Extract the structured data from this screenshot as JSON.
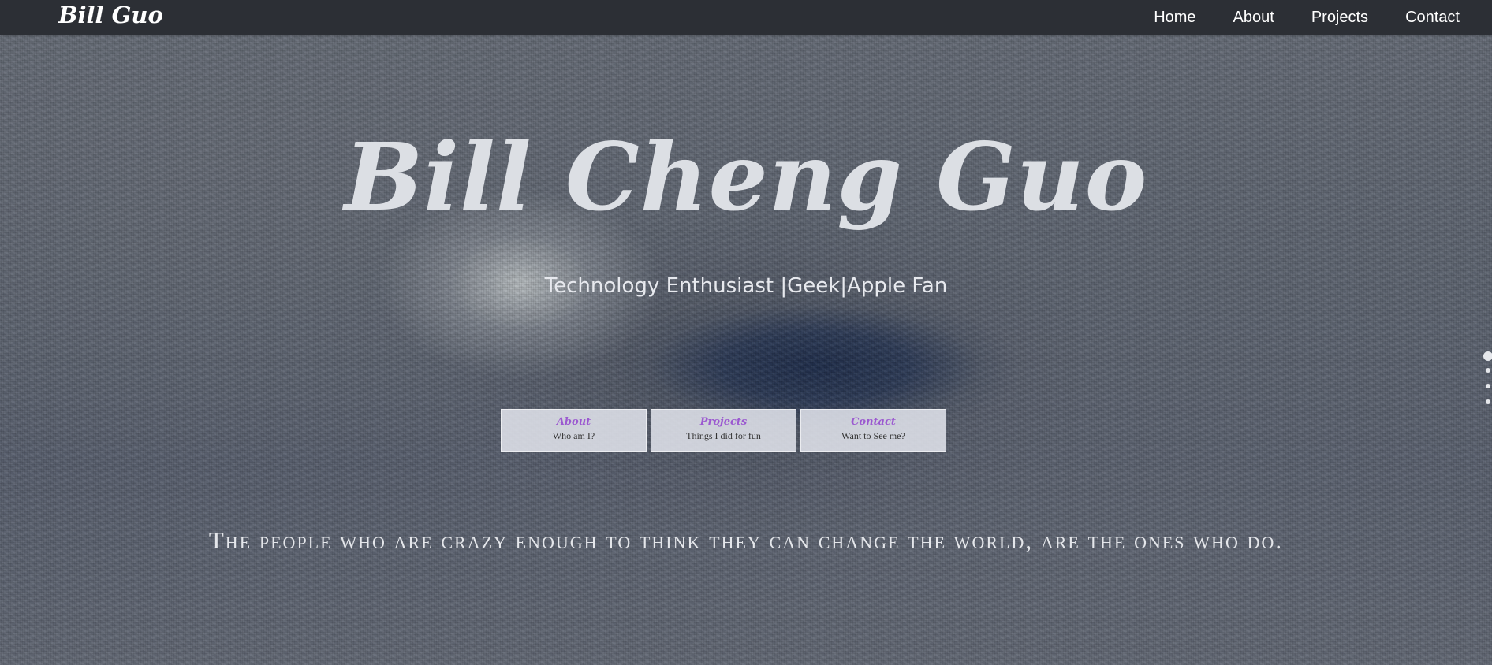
{
  "navbar": {
    "brand": "Bill Guo",
    "links": [
      {
        "label": "Home"
      },
      {
        "label": "About"
      },
      {
        "label": "Projects"
      },
      {
        "label": "Contact"
      }
    ]
  },
  "hero": {
    "title": "Bill Cheng Guo",
    "subtitle": "Technology Enthusiast |Geek|Apple Fan"
  },
  "cards": [
    {
      "title": "About",
      "subtitle": "Who am I?"
    },
    {
      "title": "Projects",
      "subtitle": "Things I did for fun"
    },
    {
      "title": "Contact",
      "subtitle": "Want to See me?"
    }
  ],
  "quote": "The people who are crazy enough to think they can change the world, are the ones who do.",
  "pager": {
    "count": 4,
    "active_index": 0
  },
  "colors": {
    "navbar_bg": "#2c2f35",
    "card_title": "#9b59d0",
    "hero_text": "#dcdfe4"
  }
}
